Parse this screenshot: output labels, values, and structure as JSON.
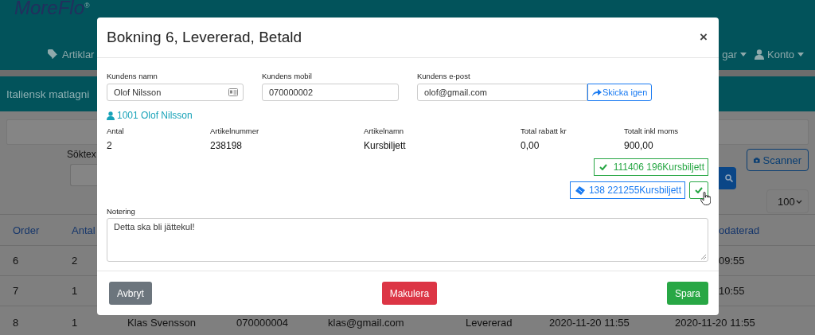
{
  "background": {
    "logo": "MoreFlo",
    "logo_mark": "®",
    "nav": [
      {
        "label": "Artiklar"
      },
      {
        "label": "gar"
      },
      {
        "label": "Konto"
      }
    ],
    "page_title": "Italiensk matlagni",
    "search_label": "Söktex",
    "scanner_button": "Scanner",
    "page_size": "100",
    "table": {
      "columns": [
        "Order",
        "Antal"
      ],
      "last_column": "odaterad",
      "rows": [
        {
          "order": "6",
          "antal": "2",
          "updated": "09:55"
        },
        {
          "order": "7",
          "antal": "1",
          "updated": "10:55"
        }
      ],
      "full_row": [
        "8",
        "1",
        "Klas Svensson",
        "070000004",
        "klas@gmail.com",
        "Levererad",
        "2020-11-20 11:55",
        "2020-11-20 11:55"
      ]
    }
  },
  "modal": {
    "title": "Bokning 6, Levererad, Betald",
    "close": "×",
    "fields": [
      {
        "label": "Kundens namn",
        "value": "Olof Nilsson",
        "kind": "card"
      },
      {
        "label": "Kundens mobil",
        "value": "070000002",
        "kind": "plain"
      },
      {
        "label": "Kundens e-post",
        "value": "olof@gmail.com",
        "kind": "button",
        "button": "Skicka igen"
      }
    ],
    "customer_link": "1001 Olof Nilsson",
    "details": [
      {
        "label": "Antal",
        "value": "2"
      },
      {
        "label": "Artikelnummer",
        "value": "238198"
      },
      {
        "label": "Artikelnamn",
        "value": "Kursbiljett"
      },
      {
        "label": "Total rabatt kr",
        "value": "0,00"
      },
      {
        "label": "Totalt inkl moms",
        "value": "900,00"
      }
    ],
    "tickets": [
      {
        "kind": "done",
        "text": "111406 196Kursbiljett"
      },
      {
        "kind": "pending",
        "text": "138 221255Kursbiljett"
      }
    ],
    "note": {
      "label": "Notering",
      "value": "Detta ska bli jättekul!"
    },
    "buttons": [
      {
        "label": "Avbryt",
        "kind": "secondary"
      },
      {
        "label": "Makulera",
        "kind": "danger"
      },
      {
        "label": "Spara",
        "kind": "success"
      }
    ]
  }
}
